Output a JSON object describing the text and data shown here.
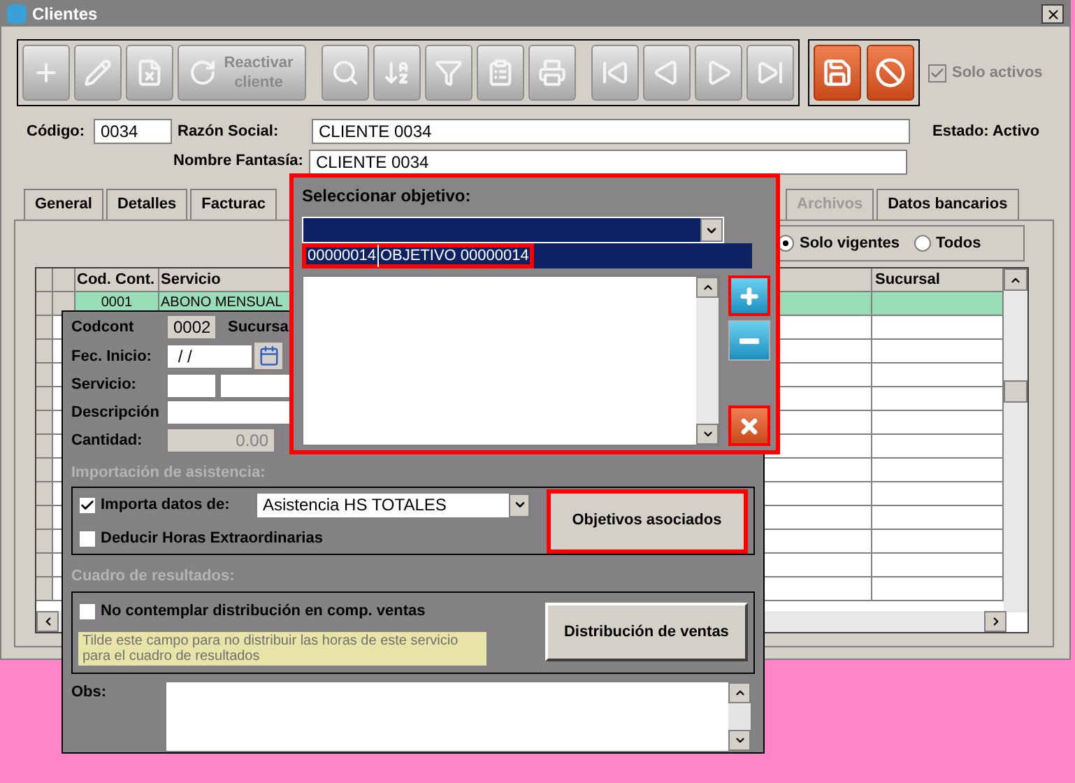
{
  "window": {
    "title": "Clientes"
  },
  "toolbar": {
    "buttons": [
      {
        "kind": "add"
      },
      {
        "kind": "edit"
      },
      {
        "kind": "delete"
      },
      {
        "kind": "reactivate",
        "label": "Reactivar cliente"
      },
      {
        "kind": "search"
      },
      {
        "kind": "sort"
      },
      {
        "kind": "filter"
      },
      {
        "kind": "report"
      },
      {
        "kind": "print"
      },
      {
        "kind": "first"
      },
      {
        "kind": "prev"
      },
      {
        "kind": "next"
      },
      {
        "kind": "last"
      }
    ],
    "actions": [
      {
        "kind": "save"
      },
      {
        "kind": "cancel"
      }
    ],
    "solo_activos": {
      "label": "Solo activos",
      "checked": true
    }
  },
  "header": {
    "codigo_label": "Código:",
    "codigo": "0034",
    "razon_label": "Razón Social:",
    "razon": "CLIENTE 0034",
    "estado": "Estado: Activo",
    "fantasia_label": "Nombre Fantasía:",
    "fantasia": "CLIENTE 0034"
  },
  "tabs": [
    {
      "label": "General",
      "selected": false,
      "disabled": false
    },
    {
      "label": "Detalles",
      "selected": false,
      "disabled": false
    },
    {
      "label": "Facturac",
      "selected": false,
      "disabled": false
    },
    {
      "label": "Archivos",
      "selected": false,
      "disabled": true
    },
    {
      "label": "Datos bancarios",
      "selected": false,
      "disabled": false
    }
  ],
  "filter": [
    {
      "label": "Solo vigentes",
      "selected": true
    },
    {
      "label": "Todos",
      "selected": false
    }
  ],
  "grid": {
    "columns": [
      "Cod. Cont.",
      "Servicio",
      "Sucursal"
    ],
    "rows": [
      {
        "cells": [
          "0001",
          "ABONO MENSUAL",
          ""
        ],
        "selected": true
      }
    ]
  },
  "detail": {
    "codcont_label": "Codcont",
    "codcont": "0002",
    "sucursal_label": "Sucursa",
    "fec_label": "Fec. Inicio:",
    "fec": " / /",
    "servicio_label": "Servicio:",
    "descripcion_label": "Descripción",
    "cantidad_label": "Cantidad:",
    "cantidad": "0.00",
    "asistencia_title": "Importación de asistencia:",
    "importa": {
      "label": "Importa datos de:",
      "checked": true
    },
    "importa_value": "Asistencia HS TOTALES",
    "deducir": {
      "label": "Deducir Horas Extraordinarias",
      "checked": false
    },
    "objetivos_button": "Objetivos asociados",
    "cuadro_title": "Cuadro de resultados:",
    "no_contemplar": {
      "label": "No contemplar distribución en comp. ventas",
      "checked": false
    },
    "hint": "Tilde este campo para no distribuir las horas de este servicio para el cuadro de resultados",
    "distribucion_button": "Distribución de ventas",
    "obs_label": "Obs:"
  },
  "popup": {
    "title": "Seleccionar objetivo:",
    "option": {
      "code": "00000014",
      "name": "OBJETIVO 00000014"
    }
  }
}
